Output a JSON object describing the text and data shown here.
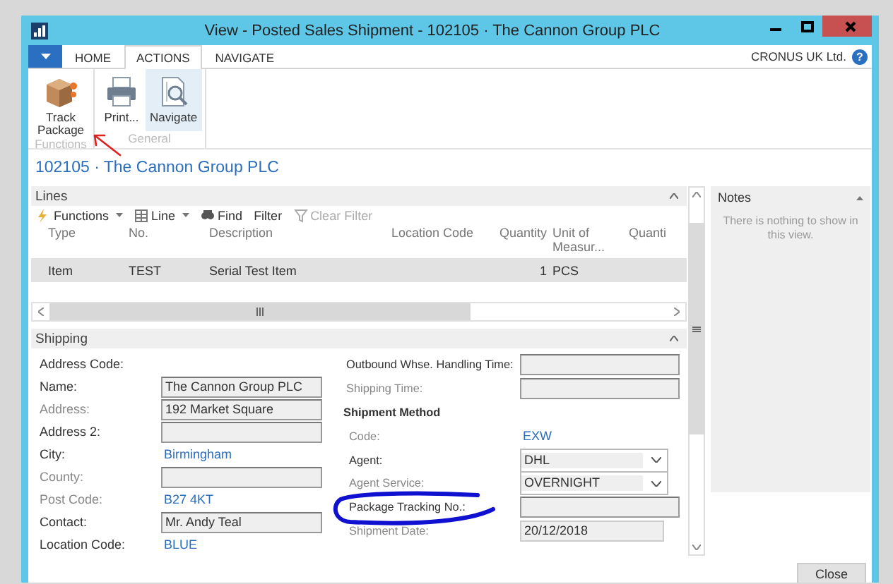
{
  "window": {
    "title": "View - Posted Sales Shipment - 102105 · The Cannon Group PLC"
  },
  "ribbon": {
    "tabs": [
      {
        "label": "HOME",
        "selected": false
      },
      {
        "label": "ACTIONS",
        "selected": true
      },
      {
        "label": "NAVIGATE",
        "selected": false
      }
    ],
    "company": "CRONUS UK Ltd.",
    "help": "?",
    "groups": [
      {
        "label": "Functions",
        "buttons": [
          {
            "label": "Track Package",
            "kind": "package",
            "selected": false
          }
        ]
      },
      {
        "label": "General",
        "buttons": [
          {
            "label": "Print...",
            "kind": "print",
            "selected": false
          },
          {
            "label": "Navigate",
            "kind": "navigate",
            "selected": true
          }
        ]
      }
    ]
  },
  "page_title": "102105 · The Cannon Group PLC",
  "lines": {
    "title": "Lines",
    "toolbar": [
      {
        "label": "Functions",
        "kind": "functions",
        "dropdown": true,
        "disabled": false
      },
      {
        "label": "Line",
        "kind": "line",
        "dropdown": true,
        "disabled": false
      },
      {
        "label": "Find",
        "kind": "find",
        "dropdown": false,
        "disabled": false
      },
      {
        "label": "Filter",
        "kind": "none",
        "dropdown": false,
        "disabled": false
      },
      {
        "label": "Clear Filter",
        "kind": "clear",
        "dropdown": false,
        "disabled": true
      }
    ],
    "columns": [
      "Type",
      "No.",
      "Description",
      "Location Code",
      "Quantity",
      "Unit of Measur...",
      "Quanti"
    ],
    "rows": [
      {
        "cells": [
          "Item",
          "TEST",
          "Serial Test Item",
          "",
          "1",
          "PCS",
          ""
        ],
        "selected": true
      }
    ]
  },
  "shipping": {
    "title": "Shipping",
    "left_fields": [
      {
        "label": "Address Code:",
        "kind": "none",
        "editable": true
      },
      {
        "label": "Name:",
        "kind": "input",
        "value": "The Cannon Group PLC",
        "editable": true
      },
      {
        "label": "Address:",
        "kind": "input",
        "value": "192 Market Square",
        "editable": false
      },
      {
        "label": "Address 2:",
        "kind": "input",
        "editable": true
      },
      {
        "label": "City:",
        "kind": "link",
        "value": "Birmingham",
        "editable": true
      },
      {
        "label": "County:",
        "kind": "input",
        "editable": false
      },
      {
        "label": "Post Code:",
        "kind": "link",
        "value": "B27 4KT",
        "editable": false
      },
      {
        "label": "Contact:",
        "kind": "input",
        "value": "Mr. Andy Teal",
        "editable": true
      },
      {
        "label": "Location Code:",
        "kind": "link",
        "value": "BLUE",
        "editable": true
      }
    ],
    "right_fields": [
      {
        "label": "Outbound Whse. Handling Time:",
        "kind": "input",
        "editable": true
      },
      {
        "label": "Shipping Time:",
        "kind": "input",
        "editable": false
      },
      {
        "label": "Shipment Method",
        "kind": "heading"
      },
      {
        "label": "Code:",
        "kind": "link",
        "value": "EXW",
        "editable": false
      },
      {
        "label": "Agent:",
        "kind": "dropdown",
        "value": "DHL",
        "editable": true
      },
      {
        "label": "Agent Service:",
        "kind": "dropdown",
        "value": "OVERNIGHT",
        "editable": false
      },
      {
        "label": "Package Tracking No.:",
        "kind": "input",
        "editable": true
      },
      {
        "label": "Shipment Date:",
        "kind": "short",
        "value": "20/12/2018",
        "editable": false
      }
    ]
  },
  "notes": {
    "title": "Notes",
    "message": "There is nothing to show in this view."
  },
  "buttons": [
    "Close"
  ]
}
